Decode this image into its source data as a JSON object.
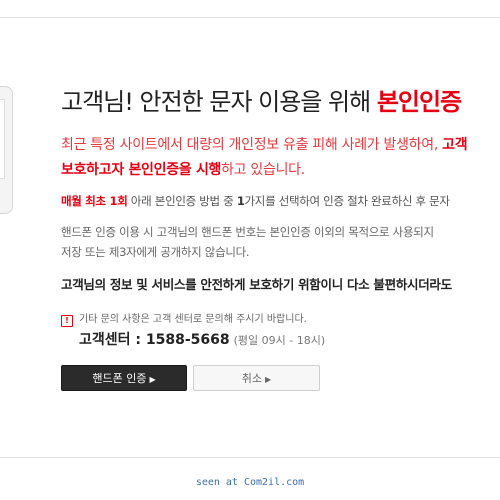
{
  "headline": {
    "prefix": "고객님! 안전한 문자 이용을 위해 ",
    "emphasis": "본인인증"
  },
  "notice": {
    "line1_prefix": "최근 특정 사이트에서 대량의 개인정보 유출 피해 사례가 발생하여, ",
    "line1_bold": "고객",
    "line2_bold_start": "보호하고자 본인인증을 시행",
    "line2_rest": "하고 있습니다."
  },
  "info1": {
    "red": "매월 최초 1회",
    "text": " 아래 본인인증 방법 중 ",
    "bold": "1",
    "tail": "가지를 선택하여 인증 절차 완료하신 후 문자"
  },
  "info2": {
    "line1": "핸드폰 인증 이용 시 고객님의 핸드폰 번호는 본인인증 이외의 목적으로 사용되지",
    "line2": "저장 또는 제3자에게 공개하지 않습니다."
  },
  "strong_line": "고객님의 정보 및 서비스를 안전하게 보호하기 위함이니 다소 불편하시더라도",
  "contact": {
    "icon_text": "!",
    "note": "기타 문의 사항은 고객 센터로 문의해 주시기 바랍니다.",
    "center_label": "고객센터 : 1588-5668",
    "hours": "(평일 09시 - 18시)"
  },
  "buttons": {
    "phone_auth": "핸드폰 인증",
    "cancel": "취소",
    "arrow": "▶"
  },
  "footer": "seen at Com2il.com",
  "colors": {
    "accent_red": "#e60012",
    "dark_button": "#2b2b2b",
    "footer_link": "#3a6fb0"
  },
  "icons": {
    "alert": "alert-icon",
    "phone": "phone-illustration"
  }
}
